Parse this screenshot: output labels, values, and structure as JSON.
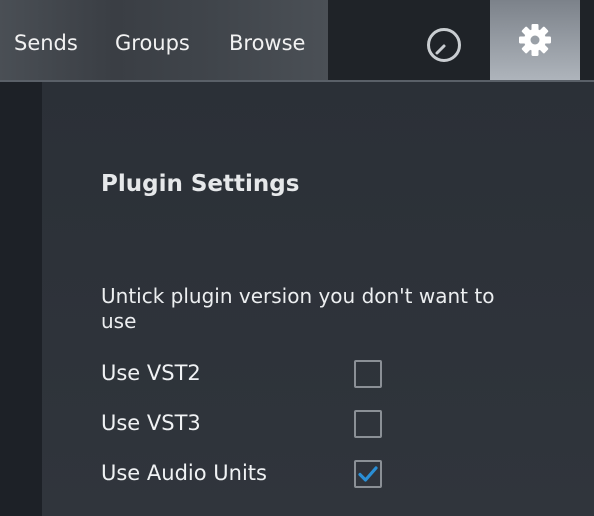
{
  "header": {
    "tabs": [
      {
        "label": "Sends"
      },
      {
        "label": "Groups"
      },
      {
        "label": "Browse"
      }
    ],
    "meter_icon": "meter-dial-icon",
    "settings_icon": "gear-icon",
    "settings_active": true
  },
  "panel": {
    "title": "Plugin Settings",
    "instructions": "Untick plugin version you don't want to use",
    "options": [
      {
        "label": "Use VST2",
        "checked": false
      },
      {
        "label": "Use VST3",
        "checked": false
      },
      {
        "label": "Use Audio Units",
        "checked": true
      }
    ]
  },
  "colors": {
    "check_accent": "#2a8fd6",
    "settings_active_bg": "#aeb4bb"
  }
}
